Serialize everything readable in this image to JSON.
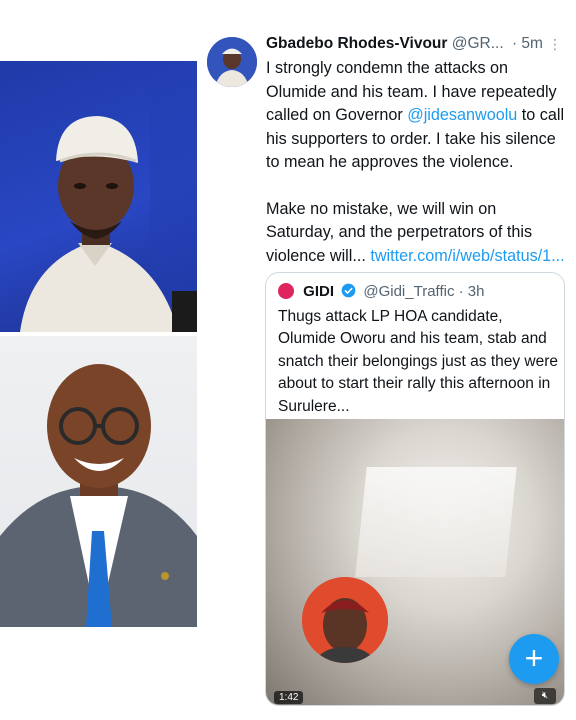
{
  "tweet": {
    "author_name": "Gbadebo Rhodes-Vivour",
    "handle": "@GR...",
    "time": "· 5m",
    "more_icon": "more-dots-icon",
    "text_1": "I strongly condemn the attacks on Olumide and his team. I have repeatedly called on Governor ",
    "mention": "@jidesanwoolu",
    "text_2": " to call his supporters to order. I take his silence to mean he approves the violence.",
    "text_3": "Make no mistake, we will win on Saturday, and the perpetrators of this violence will... ",
    "link": "twitter.com/i/web/status/1..."
  },
  "quoted": {
    "name": "GIDI",
    "verified_icon": "verified-badge-icon",
    "handle": "@Gidi_Traffic",
    "time": "· 3h",
    "text": "Thugs attack LP HOA candidate, Olumide Oworu and his team, stab and snatch their belongings just as they were about to start their rally this afternoon in Surulere...",
    "video_duration": "1:42",
    "mute_icon": "speaker-mute-icon"
  },
  "fab": {
    "label": "+",
    "icon": "compose-plus-icon"
  },
  "colors": {
    "accent": "#1d9bf0",
    "text": "#0f1419",
    "muted": "#536471",
    "border": "#cfd9de"
  }
}
